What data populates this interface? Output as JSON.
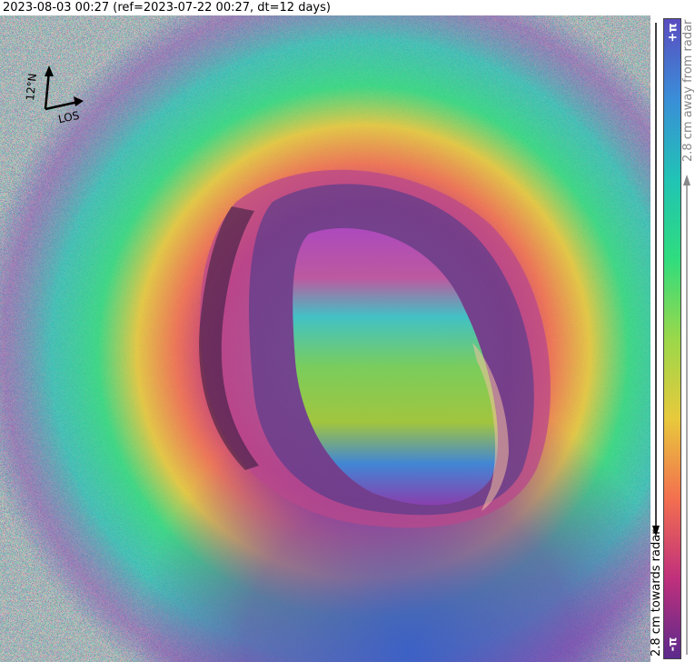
{
  "title": "2023-08-03 00:27 (ref=2023-07-22 00:27, dt=12 days)",
  "compass": {
    "north_label": "12°N",
    "los_label": "LOS"
  },
  "colorbar": {
    "top_label": "+π",
    "bottom_label": "-π",
    "away_text": "2.8 cm away from radar",
    "towards_text": "2.8 cm towards radar",
    "colors": [
      "#5b2a8c",
      "#c0307c",
      "#f36f4f",
      "#e8c93c",
      "#9ad84a",
      "#2fdc7e",
      "#21c3b5",
      "#3a8ed8",
      "#5a4cc0"
    ]
  }
}
